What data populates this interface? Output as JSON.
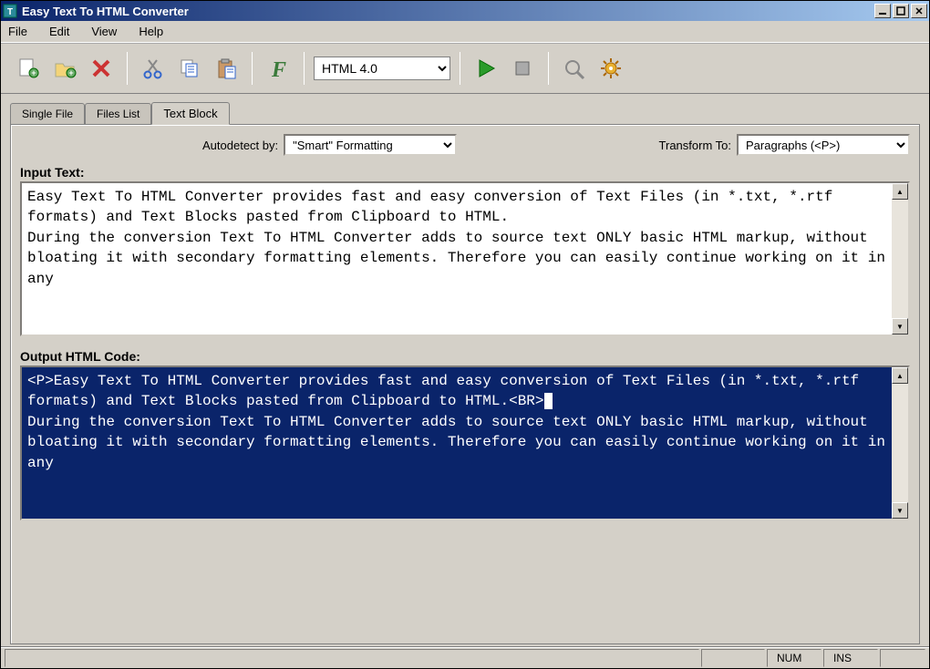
{
  "title": "Easy Text To HTML Converter",
  "menubar": [
    "File",
    "Edit",
    "View",
    "Help"
  ],
  "toolbar": {
    "format_select": "HTML 4.0"
  },
  "tabs": [
    "Single File",
    "Files List",
    "Text Block"
  ],
  "active_tab": 2,
  "controls": {
    "autodetect_label": "Autodetect by:",
    "autodetect_value": "\"Smart\" Formatting",
    "transform_label": "Transform To:",
    "transform_value": "Paragraphs (<P>)"
  },
  "input": {
    "label": "Input Text:",
    "text": "Easy Text To HTML Converter provides fast and easy conversion of Text Files (in *.txt, *.rtf formats) and Text Blocks pasted from Clipboard to HTML.\nDuring the conversion Text To HTML Converter adds to source text ONLY basic HTML markup, without bloating it with secondary formatting elements. Therefore you can easily continue working on it in any"
  },
  "output": {
    "label": "Output HTML Code:",
    "selected_text": "<P>Easy Text To HTML Converter provides fast and easy conversion of Text Files (in *.txt, *.rtf formats) and Text Blocks pasted from Clipboard to HTML.<BR>",
    "rest_text": "\nDuring the conversion Text To HTML Converter adds to source text ONLY basic HTML markup, without bloating it with secondary formatting elements. Therefore you can easily continue working on it in any"
  },
  "statusbar": {
    "num": "NUM",
    "ins": "INS"
  }
}
